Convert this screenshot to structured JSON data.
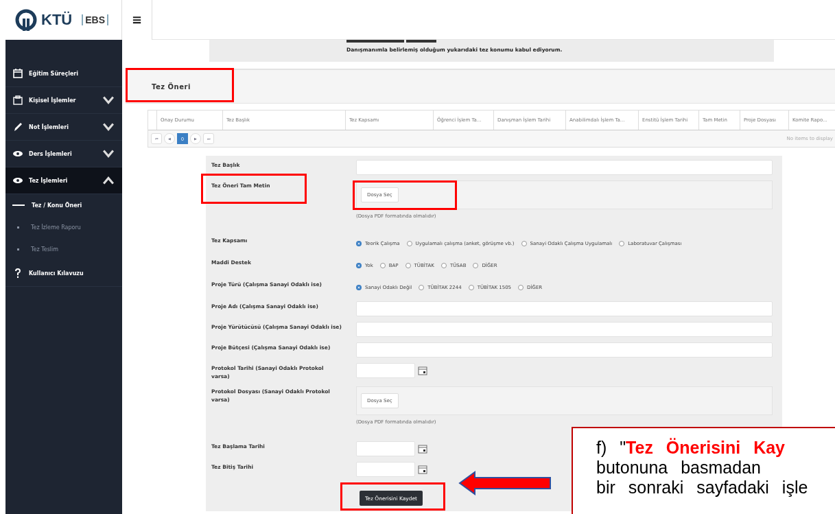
{
  "header": {
    "logo_text": "KTÜ",
    "logo_badge": "EBS",
    "menu_icon": "≡"
  },
  "sidebar": {
    "items": [
      {
        "label": "Eğitim Süreçleri",
        "expandable": false,
        "expanded": false
      },
      {
        "label": "Kişisel İşlemler",
        "expandable": true,
        "expanded": false
      },
      {
        "label": "Not İşlemleri",
        "expandable": true,
        "expanded": false
      },
      {
        "label": "Ders İşlemleri",
        "expandable": true,
        "expanded": false
      },
      {
        "label": "Tez İşlemleri",
        "expandable": true,
        "expanded": true,
        "children": [
          {
            "label": "Tez / Konu Öneri",
            "selected": true
          },
          {
            "label": "Tez İzleme Raporu",
            "selected": false
          },
          {
            "label": "Tez Teslim",
            "selected": false
          }
        ]
      },
      {
        "label": "Kullanıcı Kılavuzu",
        "expandable": false,
        "expanded": false
      }
    ]
  },
  "acceptance": {
    "text": "Danışmanımla belirlemiş olduğum yukarıdaki tez konumu kabul ediyorum."
  },
  "panel": {
    "title": "Tez Öneri",
    "highlighted": true
  },
  "table": {
    "columns": [
      "Onay Durumu",
      "Tez Başlık",
      "Tez Kapsamı",
      "Öğrenci İşlem Ta...",
      "Danışman İşlem Tarihi",
      "Anabilimdalı İşlem Ta...",
      "Enstitü İşlem Tarihi",
      "Tam Metin",
      "Proje Dosyası",
      "Komite Rapo..."
    ],
    "pager": {
      "first": "⏮",
      "prev": "◀",
      "pages": [
        {
          "label": "0",
          "selected": true
        }
      ],
      "next": "▶",
      "last": "⏭"
    },
    "empty_message": "No items to display"
  },
  "form": {
    "rows": [
      {
        "kind": "text",
        "label": "Tez Başlık",
        "highlighted": false
      },
      {
        "kind": "file",
        "label": "Tez Öneri Tam Metin",
        "button": "Dosya Seç",
        "note": "(Dosya PDF formatında olmalıdır)",
        "highlighted": true
      },
      {
        "kind": "radio",
        "label": "Tez Kapsamı",
        "highlighted": false,
        "options": [
          {
            "label": "Teorik Çalışma",
            "selected": true
          },
          {
            "label": "Uygulamalı çalışma (anket, görüşme vb.)",
            "selected": false
          },
          {
            "label": "Sanayi Odaklı Çalışma Uygulamalı",
            "selected": false
          },
          {
            "label": "Laboratuvar Çalışması",
            "selected": false
          }
        ]
      },
      {
        "kind": "radio",
        "label": "Maddi Destek",
        "highlighted": false,
        "options": [
          {
            "label": "Yok",
            "selected": true
          },
          {
            "label": "BAP",
            "selected": false
          },
          {
            "label": "TÜBİTAK",
            "selected": false
          },
          {
            "label": "TÜSAB",
            "selected": false
          },
          {
            "label": "DİĞER",
            "selected": false
          }
        ]
      },
      {
        "kind": "radio",
        "label": "Proje Türü (Çalışma Sanayi Odaklı ise)",
        "highlighted": false,
        "options": [
          {
            "label": "Sanayi Odaklı Değil",
            "selected": true
          },
          {
            "label": "TÜBİTAK 2244",
            "selected": false
          },
          {
            "label": "TÜBİTAK 1505",
            "selected": false
          },
          {
            "label": "DİĞER",
            "selected": false
          }
        ]
      },
      {
        "kind": "text",
        "label": "Proje Adı (Çalışma Sanayi Odaklı ise)",
        "highlighted": false
      },
      {
        "kind": "text",
        "label": "Proje Yürütücüsü (Çalışma Sanayi Odaklı ise)",
        "highlighted": false
      },
      {
        "kind": "text",
        "label": "Proje Bütçesi (Çalışma Sanayi Odaklı ise)",
        "highlighted": false
      },
      {
        "kind": "date",
        "label": "Protokol Tarihi (Sanayi Odaklı Protokol varsa)",
        "highlighted": false
      },
      {
        "kind": "file",
        "label": "Protokol Dosyası (Sanayi Odaklı Protokol varsa)",
        "button": "Dosya Seç",
        "note": "(Dosya PDF formatında olmalıdır)",
        "highlighted": false
      },
      {
        "kind": "date",
        "label": "Tez Başlama Tarihi",
        "highlighted": false
      },
      {
        "kind": "date",
        "label": "Tez Bitiş Tarihi",
        "highlighted": false
      }
    ],
    "save_button": "Tez Önerisini Kaydet",
    "save_highlighted": true
  },
  "callout": {
    "lines": [
      "f) \"**Tez Önerisini Kay**",
      "butonuna basmadan",
      "bir sonraki sayfadaki işle"
    ]
  }
}
